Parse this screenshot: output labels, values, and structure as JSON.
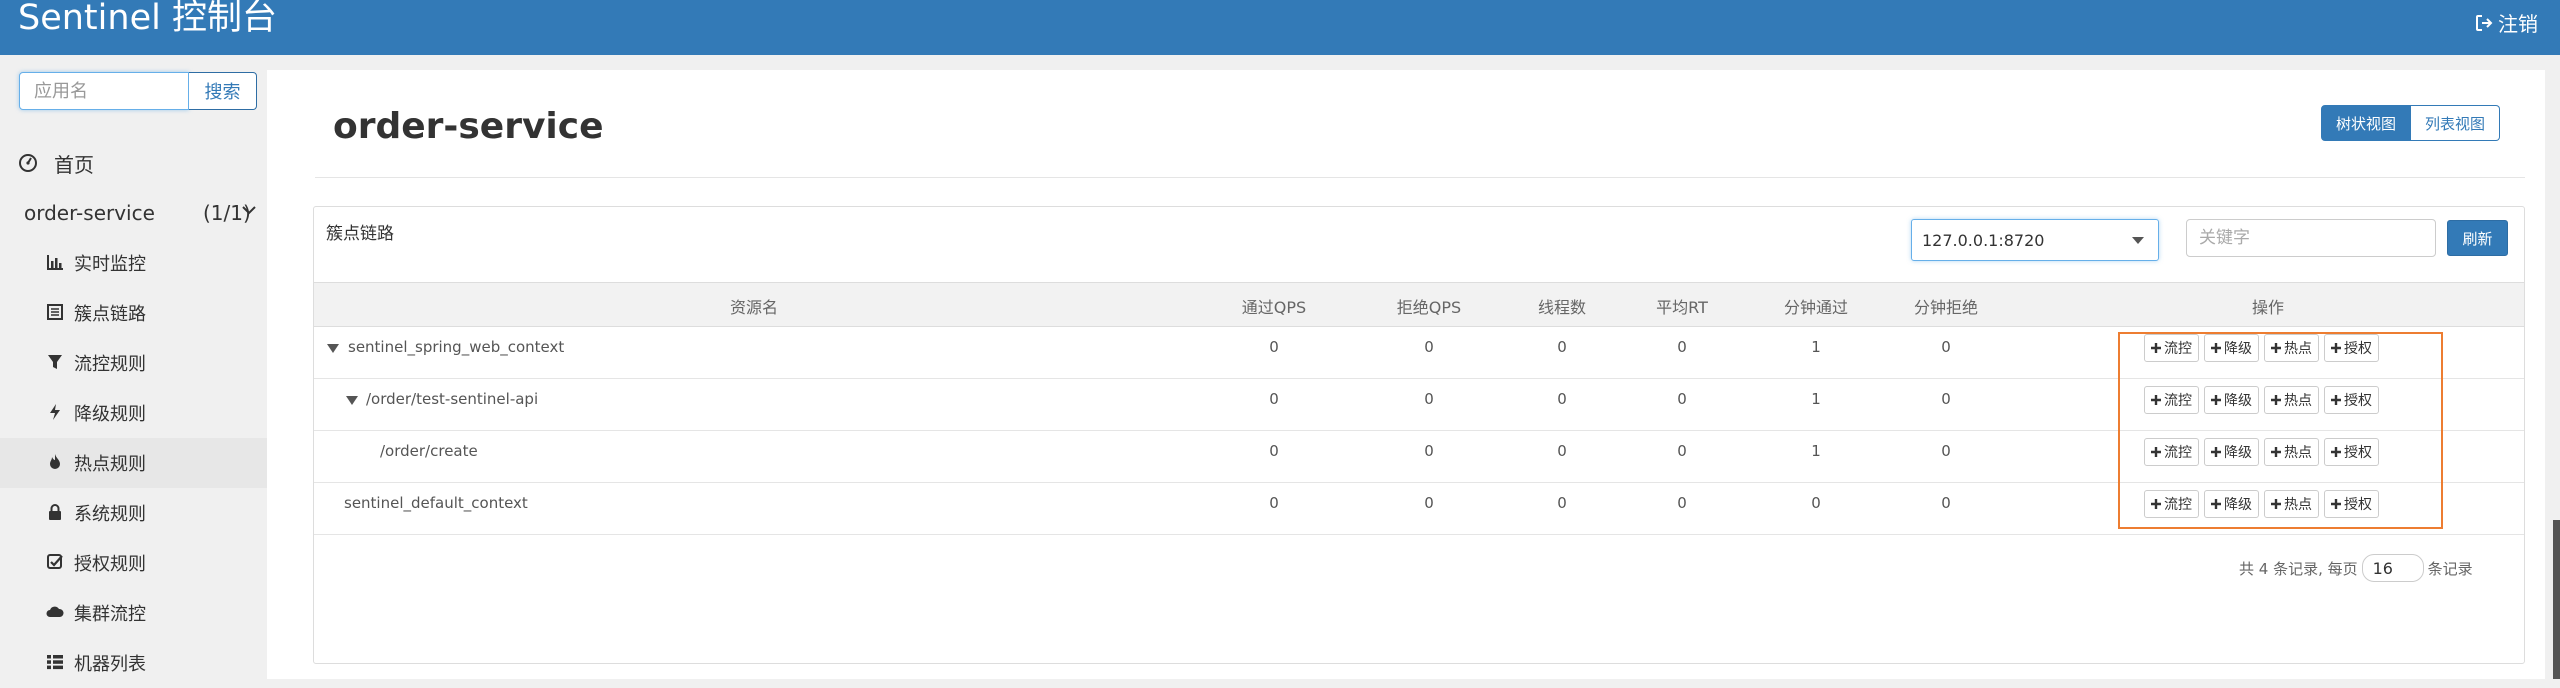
{
  "header": {
    "brand": "Sentinel 控制台",
    "logout_label": "注销"
  },
  "sidebar": {
    "search_placeholder": "应用名",
    "search_button": "搜索",
    "home_label": "首页",
    "app": {
      "name": "order-service",
      "count": "(1/1)"
    },
    "items": [
      {
        "label": "实时监控",
        "icon": "bar-chart-icon"
      },
      {
        "label": "簇点链路",
        "icon": "list-icon"
      },
      {
        "label": "流控规则",
        "icon": "filter-icon"
      },
      {
        "label": "降级规则",
        "icon": "flash-icon"
      },
      {
        "label": "热点规则",
        "icon": "fire-icon"
      },
      {
        "label": "系统规则",
        "icon": "lock-icon"
      },
      {
        "label": "授权规则",
        "icon": "check-icon"
      },
      {
        "label": "集群流控",
        "icon": "cloud-icon"
      },
      {
        "label": "机器列表",
        "icon": "th-list-icon"
      }
    ],
    "active_item": "热点规则"
  },
  "main": {
    "title": "order-service",
    "view_buttons": {
      "tree": "树状视图",
      "list": "列表视图"
    },
    "active_view": "tree",
    "card_title": "簇点链路",
    "machine": "127.0.0.1:8720",
    "keyword_placeholder": "关键字",
    "refresh_label": "刷新",
    "columns": [
      "资源名",
      "通过QPS",
      "拒绝QPS",
      "线程数",
      "平均RT",
      "分钟通过",
      "分钟拒绝",
      "操作"
    ],
    "rows": [
      {
        "name": "sentinel_spring_web_context",
        "pass_qps": "0",
        "block_qps": "0",
        "threads": "0",
        "avg_rt": "0",
        "min_pass": "1",
        "min_block": "0"
      },
      {
        "name": "/order/test-sentinel-api",
        "pass_qps": "0",
        "block_qps": "0",
        "threads": "0",
        "avg_rt": "0",
        "min_pass": "1",
        "min_block": "0"
      },
      {
        "name": "/order/create",
        "pass_qps": "0",
        "block_qps": "0",
        "threads": "0",
        "avg_rt": "0",
        "min_pass": "1",
        "min_block": "0"
      },
      {
        "name": "sentinel_default_context",
        "pass_qps": "0",
        "block_qps": "0",
        "threads": "0",
        "avg_rt": "0",
        "min_pass": "0",
        "min_block": "0"
      }
    ],
    "ops": {
      "flow": "流控",
      "degrade": "降级",
      "hot": "热点",
      "auth": "授权"
    },
    "pager": {
      "prefix": "共 4 条记录, 每页",
      "page_size": "16",
      "suffix": "条记录"
    }
  },
  "colors": {
    "primary": "#337ab7",
    "highlight": "#ed7d31"
  }
}
